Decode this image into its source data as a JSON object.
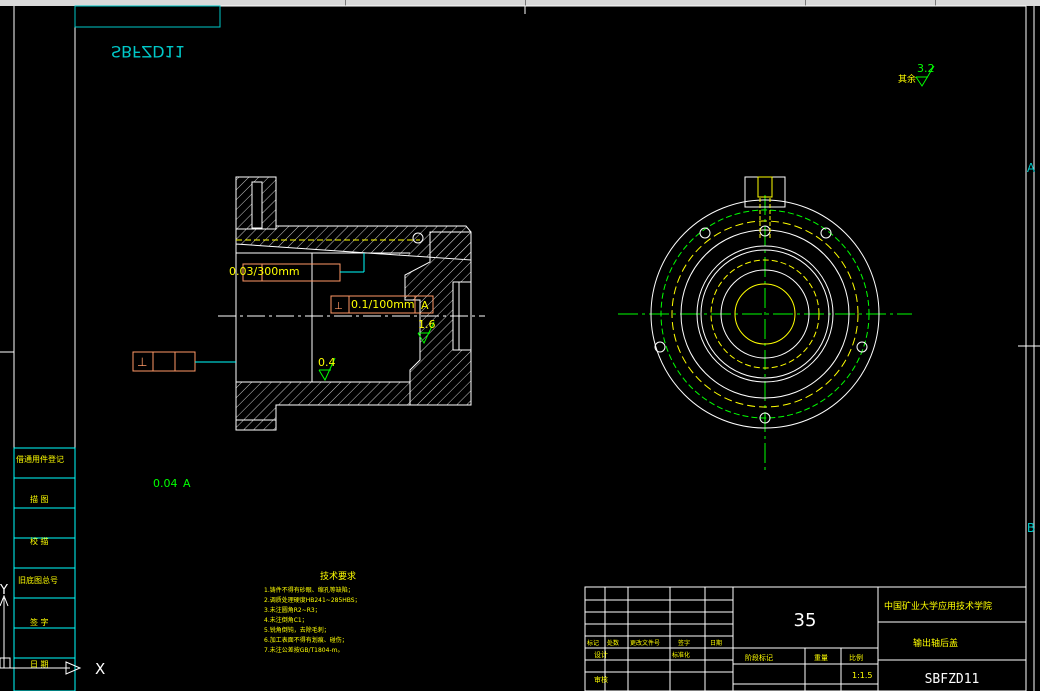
{
  "drawing": {
    "mirrored_code": "SBFZD11",
    "flatness_tolerance": "0.03/300mm",
    "perp_tolerance": "0.1/100mm",
    "perp_datum": "A",
    "roughness_bore": "0.4",
    "roughness_face": "1.6",
    "roughness_rest_value": "3.2",
    "roughness_rest_label": "其余",
    "runout_note_value": "0.04",
    "runout_note_datum": "A",
    "sheet_zone_a": "A",
    "sheet_zone_b": "B",
    "axis_y": "Y",
    "axis_x": "X"
  },
  "tech_requirements": {
    "title": "技术要求",
    "lines": [
      "1.铸件不得有砂眼、缩孔等缺陷；",
      "2.调质处理硬度HB241~285HBS；",
      "3.未注圆角R2~R3；",
      "4.未注倒角C1；",
      "5.锐角倒钝，去除毛刺；",
      "6.加工表面不得有划痕、碰伤；",
      "7.未注公差按GB/T1804-m。"
    ]
  },
  "left_panel": {
    "rows": [
      "借通用件登记",
      "描 图",
      "校 描",
      "旧底图总号",
      "签 字",
      "日 期"
    ]
  },
  "title_block": {
    "material": "35",
    "school": "中国矿业大学应用技术学院",
    "part_name": "输出轴后盖",
    "code": "SBFZD11",
    "scale_label": "比例",
    "weight_label": "重量",
    "stage_label": "阶段标记",
    "scale": "1:1.5",
    "rev_headers": [
      "标记",
      "处数",
      "更改文件号",
      "签字",
      "日期"
    ],
    "sign_headers": [
      "设计",
      "标准化"
    ],
    "bottom_label": "审核"
  }
}
